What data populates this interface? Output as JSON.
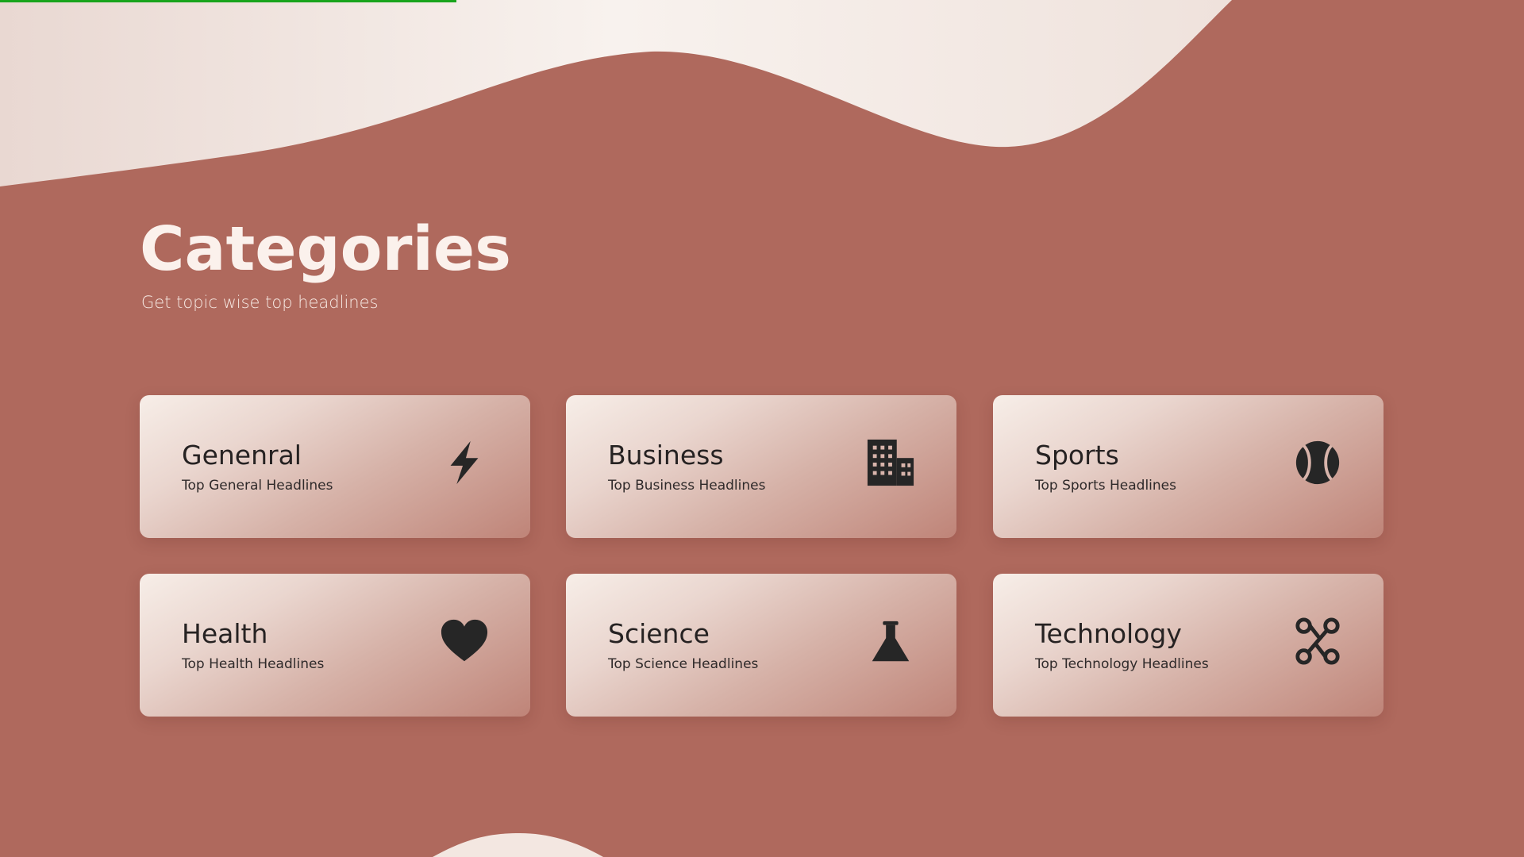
{
  "header": {
    "title": "Categories",
    "subtitle": "Get topic wise top headlines"
  },
  "colors": {
    "background": "#af695d",
    "wave": "#f4e9e4",
    "progress": "#19a41c",
    "icon": "#262626"
  },
  "categories": [
    {
      "title": "Genenral",
      "subtitle": "Top General Headlines",
      "icon": "lightning-icon"
    },
    {
      "title": "Business",
      "subtitle": "Top Business Headlines",
      "icon": "building-icon"
    },
    {
      "title": "Sports",
      "subtitle": "Top Sports Headlines",
      "icon": "ball-icon"
    },
    {
      "title": "Health",
      "subtitle": "Top Health Headlines",
      "icon": "heart-icon"
    },
    {
      "title": "Science",
      "subtitle": "Top Science Headlines",
      "icon": "flask-icon"
    },
    {
      "title": "Technology",
      "subtitle": "Top Technology Headlines",
      "icon": "route-icon"
    }
  ]
}
